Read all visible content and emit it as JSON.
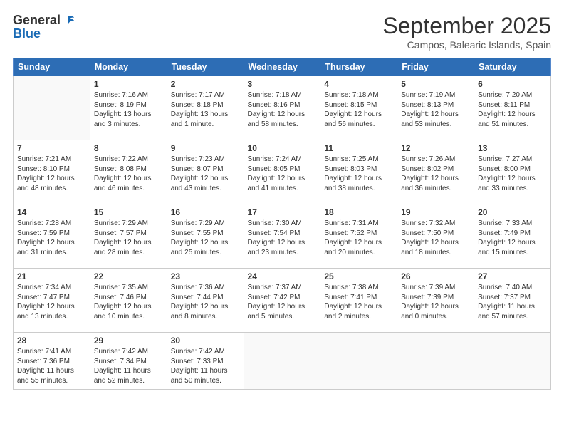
{
  "header": {
    "logo_general": "General",
    "logo_blue": "Blue",
    "month": "September 2025",
    "location": "Campos, Balearic Islands, Spain"
  },
  "days_of_week": [
    "Sunday",
    "Monday",
    "Tuesday",
    "Wednesday",
    "Thursday",
    "Friday",
    "Saturday"
  ],
  "weeks": [
    [
      {
        "day": "",
        "content": ""
      },
      {
        "day": "1",
        "content": "Sunrise: 7:16 AM\nSunset: 8:19 PM\nDaylight: 13 hours\nand 3 minutes."
      },
      {
        "day": "2",
        "content": "Sunrise: 7:17 AM\nSunset: 8:18 PM\nDaylight: 13 hours\nand 1 minute."
      },
      {
        "day": "3",
        "content": "Sunrise: 7:18 AM\nSunset: 8:16 PM\nDaylight: 12 hours\nand 58 minutes."
      },
      {
        "day": "4",
        "content": "Sunrise: 7:18 AM\nSunset: 8:15 PM\nDaylight: 12 hours\nand 56 minutes."
      },
      {
        "day": "5",
        "content": "Sunrise: 7:19 AM\nSunset: 8:13 PM\nDaylight: 12 hours\nand 53 minutes."
      },
      {
        "day": "6",
        "content": "Sunrise: 7:20 AM\nSunset: 8:11 PM\nDaylight: 12 hours\nand 51 minutes."
      }
    ],
    [
      {
        "day": "7",
        "content": "Sunrise: 7:21 AM\nSunset: 8:10 PM\nDaylight: 12 hours\nand 48 minutes."
      },
      {
        "day": "8",
        "content": "Sunrise: 7:22 AM\nSunset: 8:08 PM\nDaylight: 12 hours\nand 46 minutes."
      },
      {
        "day": "9",
        "content": "Sunrise: 7:23 AM\nSunset: 8:07 PM\nDaylight: 12 hours\nand 43 minutes."
      },
      {
        "day": "10",
        "content": "Sunrise: 7:24 AM\nSunset: 8:05 PM\nDaylight: 12 hours\nand 41 minutes."
      },
      {
        "day": "11",
        "content": "Sunrise: 7:25 AM\nSunset: 8:03 PM\nDaylight: 12 hours\nand 38 minutes."
      },
      {
        "day": "12",
        "content": "Sunrise: 7:26 AM\nSunset: 8:02 PM\nDaylight: 12 hours\nand 36 minutes."
      },
      {
        "day": "13",
        "content": "Sunrise: 7:27 AM\nSunset: 8:00 PM\nDaylight: 12 hours\nand 33 minutes."
      }
    ],
    [
      {
        "day": "14",
        "content": "Sunrise: 7:28 AM\nSunset: 7:59 PM\nDaylight: 12 hours\nand 31 minutes."
      },
      {
        "day": "15",
        "content": "Sunrise: 7:29 AM\nSunset: 7:57 PM\nDaylight: 12 hours\nand 28 minutes."
      },
      {
        "day": "16",
        "content": "Sunrise: 7:29 AM\nSunset: 7:55 PM\nDaylight: 12 hours\nand 25 minutes."
      },
      {
        "day": "17",
        "content": "Sunrise: 7:30 AM\nSunset: 7:54 PM\nDaylight: 12 hours\nand 23 minutes."
      },
      {
        "day": "18",
        "content": "Sunrise: 7:31 AM\nSunset: 7:52 PM\nDaylight: 12 hours\nand 20 minutes."
      },
      {
        "day": "19",
        "content": "Sunrise: 7:32 AM\nSunset: 7:50 PM\nDaylight: 12 hours\nand 18 minutes."
      },
      {
        "day": "20",
        "content": "Sunrise: 7:33 AM\nSunset: 7:49 PM\nDaylight: 12 hours\nand 15 minutes."
      }
    ],
    [
      {
        "day": "21",
        "content": "Sunrise: 7:34 AM\nSunset: 7:47 PM\nDaylight: 12 hours\nand 13 minutes."
      },
      {
        "day": "22",
        "content": "Sunrise: 7:35 AM\nSunset: 7:46 PM\nDaylight: 12 hours\nand 10 minutes."
      },
      {
        "day": "23",
        "content": "Sunrise: 7:36 AM\nSunset: 7:44 PM\nDaylight: 12 hours\nand 8 minutes."
      },
      {
        "day": "24",
        "content": "Sunrise: 7:37 AM\nSunset: 7:42 PM\nDaylight: 12 hours\nand 5 minutes."
      },
      {
        "day": "25",
        "content": "Sunrise: 7:38 AM\nSunset: 7:41 PM\nDaylight: 12 hours\nand 2 minutes."
      },
      {
        "day": "26",
        "content": "Sunrise: 7:39 AM\nSunset: 7:39 PM\nDaylight: 12 hours\nand 0 minutes."
      },
      {
        "day": "27",
        "content": "Sunrise: 7:40 AM\nSunset: 7:37 PM\nDaylight: 11 hours\nand 57 minutes."
      }
    ],
    [
      {
        "day": "28",
        "content": "Sunrise: 7:41 AM\nSunset: 7:36 PM\nDaylight: 11 hours\nand 55 minutes."
      },
      {
        "day": "29",
        "content": "Sunrise: 7:42 AM\nSunset: 7:34 PM\nDaylight: 11 hours\nand 52 minutes."
      },
      {
        "day": "30",
        "content": "Sunrise: 7:42 AM\nSunset: 7:33 PM\nDaylight: 11 hours\nand 50 minutes."
      },
      {
        "day": "",
        "content": ""
      },
      {
        "day": "",
        "content": ""
      },
      {
        "day": "",
        "content": ""
      },
      {
        "day": "",
        "content": ""
      }
    ]
  ]
}
